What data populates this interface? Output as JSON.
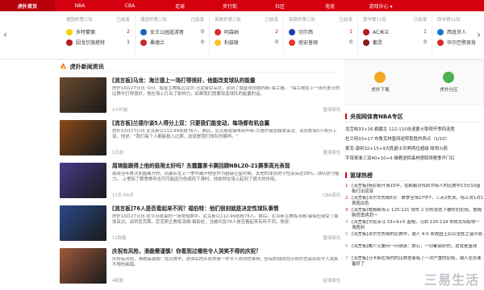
{
  "nav": {
    "logo": "虎扑首页",
    "items": [
      "NBA",
      "CBA",
      "足球",
      "步行街",
      "社区",
      "电竞",
      "游戏中心 ▾"
    ]
  },
  "scoreboard": {
    "prev_label": "‹",
    "next_label": "›",
    "matches": [
      {
        "league": "德国杯第二轮",
        "status": "已结束",
        "teams": [
          {
            "name": "多特蒙德",
            "score": "2",
            "color": "#f5d000",
            "win": true
          },
          {
            "name": "因戈尔施塔特",
            "score": "1",
            "color": "#b71c1c",
            "win": false
          }
        ]
      },
      {
        "league": "德国杯第二轮",
        "status": "已结束",
        "teams": [
          {
            "name": "女王公园巡游者",
            "score": "0",
            "color": "#1565c0",
            "win": false
          },
          {
            "name": "桑德兰",
            "score": "0",
            "color": "#c62828",
            "win": false
          }
        ]
      },
      {
        "league": "英联杯第三轮",
        "status": "已结束",
        "teams": [
          {
            "name": "阿森纳",
            "score": "2",
            "color": "#d32f2f",
            "win": true
          },
          {
            "name": "利兹联",
            "score": "0",
            "color": "#fbc02d",
            "win": false
          }
        ]
      },
      {
        "league": "英联杯第三轮",
        "status": "已结束",
        "teams": [
          {
            "name": "切尔西",
            "score": "1",
            "color": "#1e40af",
            "win": true
          },
          {
            "name": "南安普顿",
            "score": "0",
            "color": "#e53935",
            "win": false
          }
        ]
      },
      {
        "league": "意甲第11轮",
        "status": "已结束",
        "teams": [
          {
            "name": "AC米兰",
            "score": "1",
            "color": "#b71c1c",
            "win": true
          },
          {
            "name": "都灵",
            "score": "0",
            "color": "#8d1b1b",
            "win": false
          }
        ]
      },
      {
        "league": "西甲第11轮",
        "status": "已结束",
        "teams": [
          {
            "name": "西班牙人",
            "score": "1",
            "color": "#1976d2",
            "win": false
          },
          {
            "name": "毕尔巴鄂竞技",
            "score": "1",
            "color": "#d32f2f",
            "win": false
          }
        ]
      }
    ]
  },
  "news_section": {
    "title": "虎扑新闻资讯",
    "items": [
      {
        "title": "[流言板]马龙：海兰德上一场打得很好，他能改变球队的能量",
        "summary": "虎扑10月27日讯 今日，掘金主教练迈克尔-马龙接受采访，谈到了掘金球员鲍内斯-海兰德。 \"海兰德在上一场与勇士的比赛中打得很好，他在场上打出了影响力，如果我们想要改变球队的能量的话，",
        "time": "1小时前",
        "source": "篮球资讯",
        "thumb": "#6b4a2e"
      },
      {
        "title": "[流言板]兰德尔谈5人得分上双：只要我们能变动，每场都有机会赢",
        "summary": "虎扑10月27日讯 尼克斯以112-99击败76人。赛后，尼克斯前锋朱利叶斯-兰德尔接受媒体采访。谈到本场5人得分上双，他说：\"我们每个人都能投入比赛，这就是我们球队的模样。\"",
        "time": "1日前",
        "source": "篮球资讯",
        "thumb": "#8a4a1a"
      },
      {
        "title": "周琦能跟得上他的极限太好吗？东霞露茶卡赛回顾NBL20-21赛季高光表现",
        "summary": "周琦当年首次加盟离开的，风暴队在上一季中离开他但作为超级巨星时期，其他的球员防守性变高达28%，球队防守能力。 上季除了赛季首年也可可能因为伤病而下滑时，他依然在场上起到了很大的作用。",
        "time": "17天 69评",
        "source": "CBA资讯",
        "thumb": "#4a3a8a"
      },
      {
        "title": "[流言板]76人是否看起来不同？福伯特：他们很刻就是决定性球队事情",
        "summary": "虎扑10月27日讯 在今日结束的一场常规赛中，尼克斯以112-99击败76人。赛后，尼克斯主教练汤姆-锡伯杜接受了媒体采访。谈到尼克斯。尼克斯主教练汤姆-锡伯杜，当被问及76人是否看起来有所不同，他说：",
        "time": "12回复",
        "source": "篮球资讯",
        "thumb": "#2a4a8a"
      },
      {
        "title": "庆祝有风险，滑跪需谨慎！你看到过哪些令人哭笑不得的庆祝？",
        "summary": "庆祝有风险，滑跪需谨慎！在比赛中，进球后的庆祝本是一件令人欢欣的事情，但有的球员在庆祝时也会出现令人哭笑不得的画面。",
        "time": "4回复",
        "source": "足球资讯",
        "thumb": "#a05a3a"
      }
    ]
  },
  "apps": [
    {
      "label": "虎扑下载",
      "color": "#f5a623"
    },
    {
      "label": "虎扑社区",
      "color": "#4caf50"
    }
  ],
  "nba_section": {
    "title": "央视网体育NBA专区",
    "links": [
      "龙舌帕33+16 鹈鹕主 122-110击退爵士取得开季四连胜",
      "杜兰特33+17 布鲁克林篮网逆转取胜的两点（1/10）",
      "麦克-康利32+15+9大胜爵士灰熊两位超级 绿领火箭",
      "字母哥准三双40+10+9 雄鹿逆转森林狼取得赛季开门红"
    ]
  },
  "hot_section": {
    "title": "篮球热榜",
    "items": [
      "[流言板]扬尼斯开场15中，在鹈鹕对阵凯尔特人的比赛中13分10篮板打出双双",
      "[流言板]法尔文伤病5分：赛季全场17中7，三点2失误，场上对1对1表现出色",
      "[流言板]詹姆斯场上 125-121 领先 2 分的状态下被吹罚犯规，詹姆斯罚丢两罚一",
      "[流言板]文班亚马 33+9+5 盖帽，马刺 120-114 击败太阳取得一场胜利",
      "[流言板]法尔文伤病的比赛中，湖人 4-0 击败国王后以全胜之姿开局",
      "[流言板]威少又要问一问球迷：放心，一切都会好的，这就是篮球",
      "[流言板]马卡斯在场内的比赛里面临了一次严重的犯规，湖人全员准备好了"
    ]
  },
  "watermark": "三易生活"
}
